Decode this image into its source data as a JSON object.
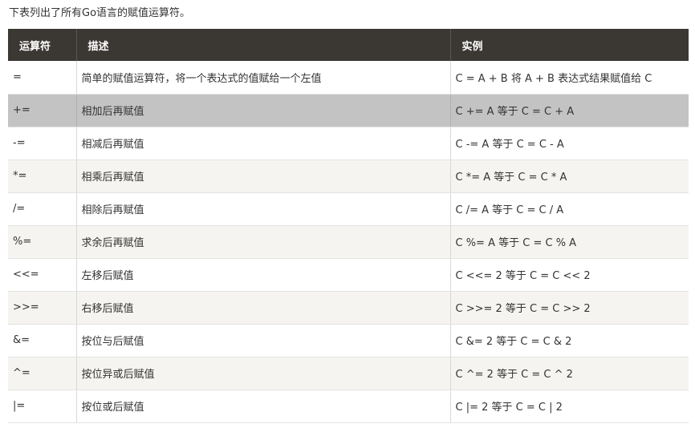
{
  "intro": "下表列出了所有Go语言的赋值运算符。",
  "columns": [
    "运算符",
    "描述",
    "实例"
  ],
  "rows": [
    {
      "op": "=",
      "desc": "简单的赋值运算符，将一个表达式的值赋给一个左值",
      "example": "C = A + B 将 A + B 表达式结果赋值给 C"
    },
    {
      "op": "+=",
      "desc": "相加后再赋值",
      "example": "C += A 等于 C = C + A"
    },
    {
      "op": "-=",
      "desc": "相减后再赋值",
      "example": "C -= A 等于 C = C - A"
    },
    {
      "op": "*=",
      "desc": "相乘后再赋值",
      "example": "C *= A 等于 C = C * A"
    },
    {
      "op": "/=",
      "desc": "相除后再赋值",
      "example": "C /= A 等于 C = C / A"
    },
    {
      "op": "%=",
      "desc": "求余后再赋值",
      "example": "C %= A 等于 C = C % A"
    },
    {
      "op": "<<=",
      "desc": "左移后赋值",
      "example": "C <<= 2 等于 C = C << 2"
    },
    {
      "op": ">>=",
      "desc": "右移后赋值",
      "example": "C >>= 2 等于 C = C >> 2"
    },
    {
      "op": "&=",
      "desc": "按位与后赋值",
      "example": "C &= 2 等于 C = C & 2"
    },
    {
      "op": "^=",
      "desc": "按位异或后赋值",
      "example": "C ^= 2 等于 C = C ^ 2"
    },
    {
      "op": "|=",
      "desc": "按位或后赋值",
      "example": "C |= 2 等于 C = C | 2"
    }
  ],
  "colors": {
    "header_bg": "#3b3733",
    "header_text": "#ffffff",
    "row_alt_bg": "#f6f4f0",
    "row_hover_bg": "#c3c3c3"
  }
}
